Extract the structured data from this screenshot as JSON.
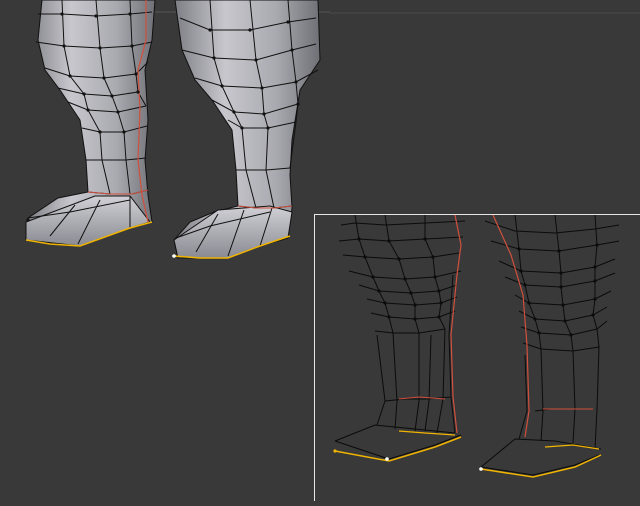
{
  "scene": {
    "mode": "edit-mesh",
    "colors": {
      "background": "#393939",
      "mesh_fill_light": "#c6c6cc",
      "mesh_fill_dark": "#6f6f75",
      "wire": "#111111",
      "seam": "#c0392b",
      "selected_edge": "#f0b400",
      "inset_border": "#e6e6e6",
      "header_accent": "#2a6fd6"
    }
  },
  "main_view": {
    "objects": [
      "left-leg-solid",
      "right-leg-solid"
    ],
    "shading": "solid"
  },
  "inset_view": {
    "objects": [
      "left-leg-wire",
      "right-leg-wire"
    ],
    "shading": "wireframe"
  }
}
